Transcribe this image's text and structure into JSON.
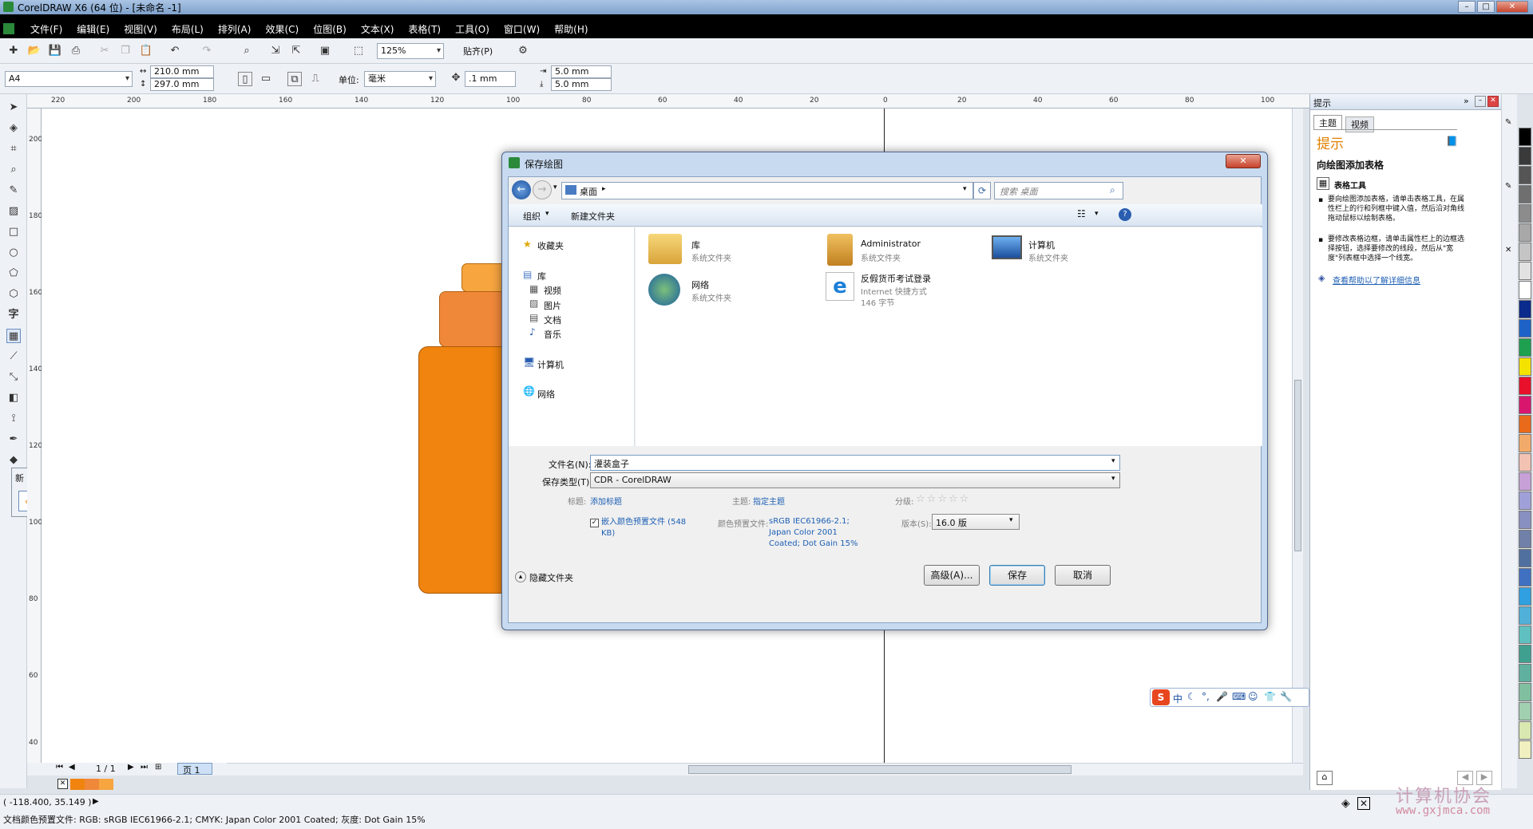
{
  "app": {
    "title": "CorelDRAW X6 (64 位) - [未命名 -1]"
  },
  "menu": [
    "文件(F)",
    "编辑(E)",
    "视图(V)",
    "布局(L)",
    "排列(A)",
    "效果(C)",
    "位图(B)",
    "文本(X)",
    "表格(T)",
    "工具(O)",
    "窗口(W)",
    "帮助(H)"
  ],
  "toolbar": {
    "zoom": "125%",
    "snap": "贴齐(P)"
  },
  "propbar": {
    "page_size": "A4",
    "width": "210.0 mm",
    "height": "297.0 mm",
    "unit_label": "单位:",
    "unit": "毫米",
    "nudge": ".1 mm",
    "dup_x": "5.0 mm",
    "dup_y": "5.0 mm"
  },
  "ruler": {
    "top": [
      "220",
      "200",
      "180",
      "160",
      "140",
      "120",
      "100",
      "80",
      "60",
      "40",
      "20",
      "0",
      "20",
      "40",
      "60",
      "80",
      "100"
    ],
    "left": [
      "200",
      "180",
      "160",
      "140",
      "120",
      "100",
      "80",
      "60",
      "40"
    ]
  },
  "page_nav": {
    "count": "1 / 1",
    "tab": "页 1"
  },
  "flyout": {
    "label": "新"
  },
  "right_panel": {
    "header": "提示",
    "tabs": [
      "主题",
      "视频"
    ],
    "title": "提示",
    "section_title": "向绘图添加表格",
    "tool_name": "表格工具",
    "bullet1": "要向绘图添加表格，请单击表格工具，在属性栏上的行和列框中键入值，然后沿对角线拖动鼠标以绘制表格。",
    "bullet2": "要修改表格边框，请单击属性栏上的边框选择按钮，选择要修改的线段，然后从\"宽度\"列表框中选择一个线宽。",
    "help_link": "查看帮助以了解详细信息"
  },
  "status": {
    "coords": "( -118.400, 35.149 )",
    "color_profile": "文档颜色预置文件: RGB: sRGB IEC61966-2.1; CMYK: Japan Color 2001 Coated; 灰度: Dot Gain 15%"
  },
  "ime": {
    "label": "中"
  },
  "watermark": {
    "text": "计算机协会",
    "url": "www.gxjmca.com"
  },
  "dialog": {
    "title": "保存绘图",
    "location": "桌面",
    "search_placeholder": "搜索 桌面",
    "organize": "组织",
    "new_folder": "新建文件夹",
    "nav": {
      "favorites": "收藏夹",
      "library": "库",
      "video": "视频",
      "pictures": "图片",
      "docs": "文档",
      "music": "音乐",
      "computer": "计算机",
      "network": "网络"
    },
    "items": [
      {
        "name": "库",
        "sub": "系统文件夹"
      },
      {
        "name": "Administrator",
        "sub": "系统文件夹"
      },
      {
        "name": "计算机",
        "sub": "系统文件夹"
      },
      {
        "name": "网络",
        "sub": "系统文件夹"
      },
      {
        "name": "反假货币考试登录",
        "sub": "Internet 快捷方式",
        "size": "146 字节"
      }
    ],
    "filename_label": "文件名(N):",
    "filename": "灌装盒子",
    "type_label": "保存类型(T):",
    "type": "CDR - CorelDRAW",
    "tag_label": "标题:",
    "tag_link": "添加标题",
    "subject_label": "主题:",
    "subject_link": "指定主题",
    "rating_label": "分级:",
    "embed_label": "嵌入颜色预置文件 (548 KB)",
    "profile_label": "颜色预置文件:",
    "profile_value_1": "sRGB IEC61966-2.1;",
    "profile_value_2": "Japan Color 2001",
    "profile_value_3": "Coated; Dot Gain 15%",
    "version_label": "版本(S):",
    "version": "16.0 版",
    "hide_folders": "隐藏文件夹",
    "advanced": "高级(A)...",
    "save": "保存",
    "cancel": "取消"
  },
  "colors": {
    "orange_top": "#f6a53f",
    "orange_mid": "#f0883a",
    "orange_body": "#f0840f",
    "accent": "#1d5fb4",
    "palette": [
      "#000000",
      "#3a3a3a",
      "#555555",
      "#6f6f6f",
      "#8c8c8c",
      "#a8a8a8",
      "#c5c5c5",
      "#e2e2e2",
      "#ffffff",
      "#0a2a8c",
      "#1e62c8",
      "#1ea050",
      "#f4e300",
      "#e8102a",
      "#d8166e",
      "#e86a1a",
      "#f2aa6a",
      "#f2c2b2",
      "#c8a0d8",
      "#a0a0d8",
      "#8890c0",
      "#7080a8",
      "#5070a0",
      "#4070c0",
      "#30a0e0",
      "#50b0d8",
      "#60c0c0",
      "#40a090",
      "#60b0a0",
      "#80c0a0",
      "#a0d0b0",
      "#d8e8b0",
      "#f0f0c0"
    ]
  }
}
